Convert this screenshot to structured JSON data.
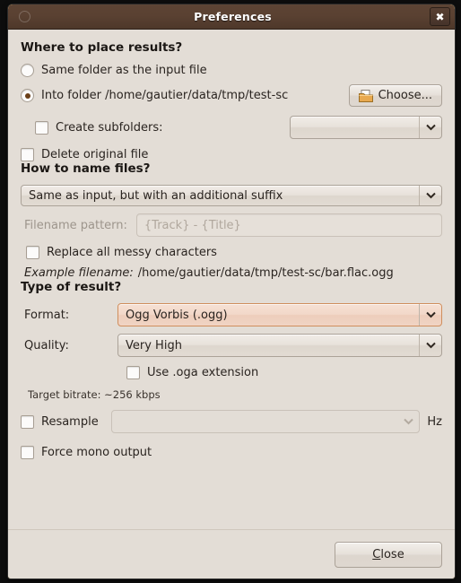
{
  "window": {
    "title": "Preferences",
    "close_icon": "close-icon",
    "menu_icon": "window-menu-icon"
  },
  "sections": {
    "where": {
      "heading": "Where to place results?",
      "radio_same_folder": "Same folder as the input file",
      "radio_into_folder": "Into folder /home/gautier/data/tmp/test-sc",
      "choose_button": "Choose...",
      "choose_icon": "folder-icon",
      "create_subfolders": "Create subfolders:",
      "subfolders_value": "",
      "delete_original": "Delete original file"
    },
    "naming": {
      "heading": "How to name files?",
      "scheme_value": "Same as input, but with an additional suffix",
      "pattern_label": "Filename pattern:",
      "pattern_value": "{Track} - {Title}",
      "replace_messy": "Replace all messy characters",
      "example_label": "Example filename:",
      "example_value": "/home/gautier/data/tmp/test-sc/bar.flac.ogg"
    },
    "result": {
      "heading": "Type of result?",
      "format_label": "Format:",
      "format_value": "Ogg Vorbis (.ogg)",
      "quality_label": "Quality:",
      "quality_value": "Very High",
      "use_oga": "Use .oga extension",
      "bitrate": "Target bitrate: ~256 kbps",
      "resample": "Resample",
      "resample_value": "",
      "hz": "Hz",
      "force_mono": "Force mono output"
    }
  },
  "footer": {
    "close_label_pre": "C",
    "close_label_post": "lose"
  },
  "colors": {
    "titlebar": "#5a4132",
    "background": "#e3ddd6",
    "accent": "#6b3f18",
    "focus_border": "#d08e5d",
    "corner": "#e8a13c"
  }
}
